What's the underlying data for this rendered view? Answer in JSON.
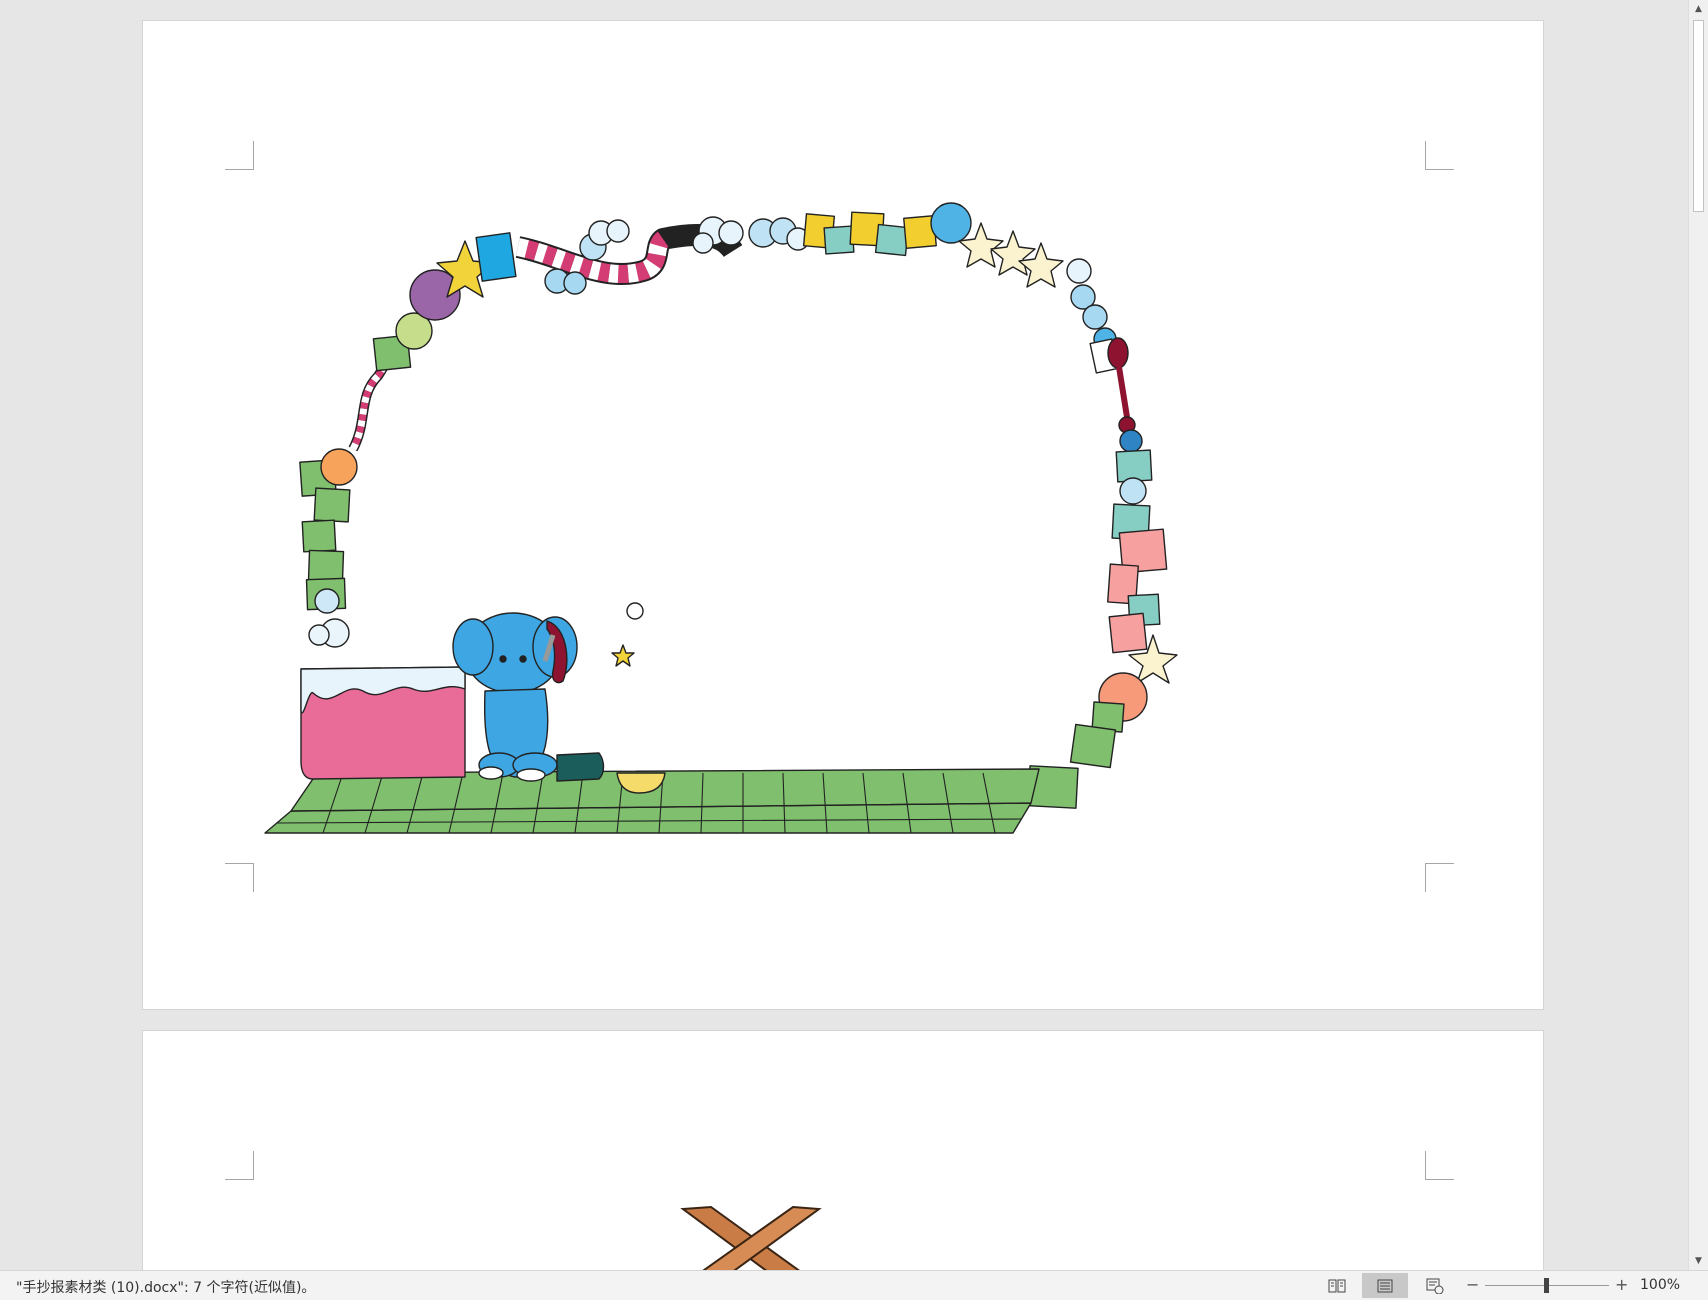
{
  "document": {
    "pages": [
      {
        "name": "page-1",
        "content": "decorative frame clip art with blue elephant and bathtub"
      },
      {
        "name": "page-2",
        "content": "crossed wooden planks clip art"
      }
    ]
  },
  "statusbar": {
    "doc_info": "\"手抄报素材类 (10).docx\": 7 个字符(近似值)。",
    "zoom_level": "100%",
    "zoom_minus": "−",
    "zoom_plus": "+",
    "views": [
      {
        "icon": "read-mode-icon",
        "active": false
      },
      {
        "icon": "print-layout-icon",
        "active": true
      },
      {
        "icon": "web-layout-icon",
        "active": false
      }
    ],
    "zoom_percent": 100
  },
  "colors": {
    "workspace": "#e6e6e6",
    "page": "#ffffff",
    "elephant": "#3ea6e2",
    "tub": "#e96c98",
    "floor": "#7fbf6e"
  }
}
